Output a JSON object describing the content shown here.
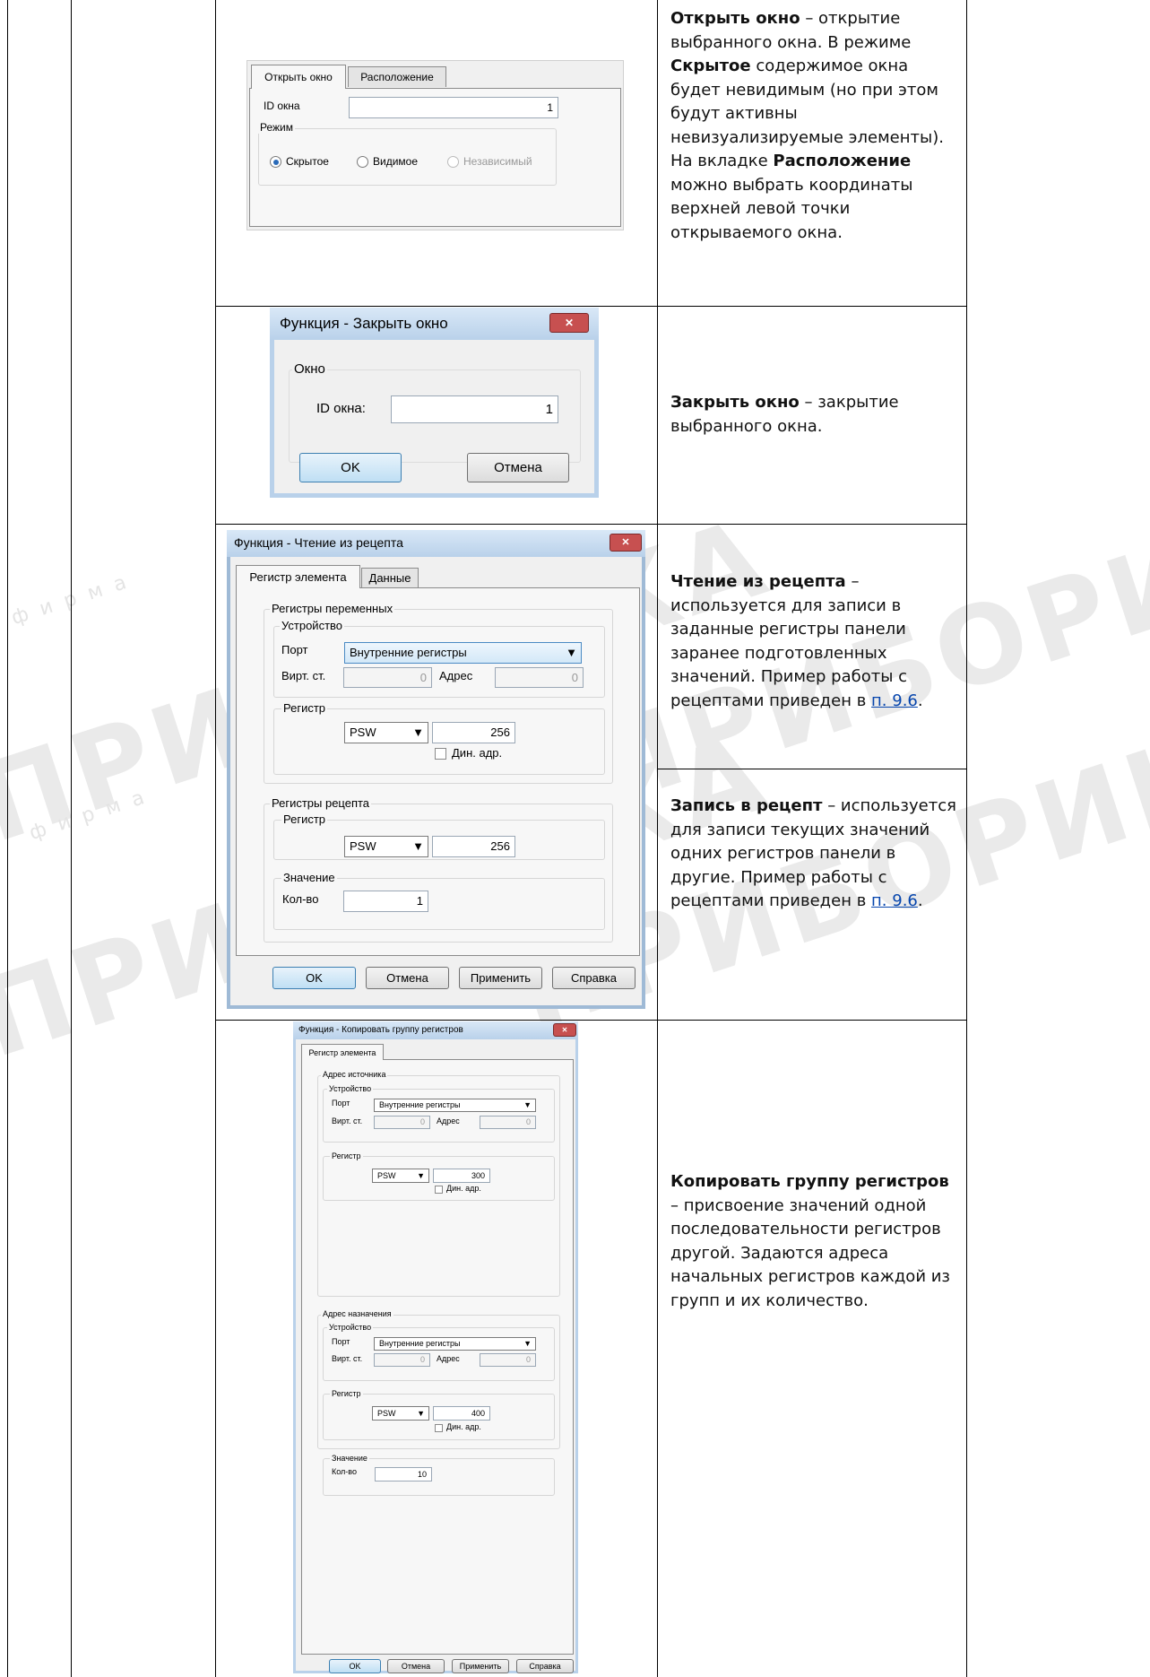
{
  "watermark": {
    "brand": "ПРИБОРИКА",
    "word": "фирма"
  },
  "rows": [
    {
      "html": "<b>Открыть окно</b> – открытие выбранного окна. В режиме <b>Скрытое</b> содержимое окна будет невидимым (но при этом будут активны невизуализируемые элементы). На вкладке <b>Расположение</b> можно выбрать координаты верхней левой точки открываемого окна."
    },
    {
      "html": "<b>Закрыть окно</b> – закрытие выбранного окна."
    },
    {
      "html": "<b>Чтение из рецепта</b> – используется для записи в заданные регистры панели заранее подготовленных значений. Пример работы с рецептами приведен в <a>п. 9.6</a>."
    },
    {
      "html": "<b>Запись в рецепт</b> – используется для записи текущих значений одних регистров панели в другие. Пример работы с рецептами приведен в <a>п. 9.6</a>."
    },
    {
      "html": "<b>Копировать группу регистров</b> – присвоение значений одной последовательности регистров другой. Задаются адреса начальных регистров каждой из групп и их количество."
    }
  ],
  "dlg_open": {
    "tab1": "Открыть окно",
    "tab2": "Расположение",
    "id_label": "ID окна",
    "id_value": "1",
    "mode_label": "Режим",
    "opt1": "Скрытое",
    "opt2": "Видимое",
    "opt3": "Независимый"
  },
  "dlg_close": {
    "title": "Функция - Закрыть окно",
    "close_glyph": "✕",
    "group": "Окно",
    "id_label": "ID окна:",
    "id_value": "1",
    "ok": "OK",
    "cancel": "Отмена"
  },
  "dlg_recipe": {
    "title": "Функция - Чтение из рецепта",
    "close_glyph": "✕",
    "tab1": "Регистр элемента",
    "tab2": "Данные",
    "grp_vars": "Регистры переменных",
    "grp_device": "Устройство",
    "port_label": "Порт",
    "port_value": "Внутренние регистры",
    "virt_label": "Вирт. ст.",
    "virt_value": "0",
    "addr_label": "Адрес",
    "addr_value": "0",
    "grp_reg": "Регистр",
    "reg_type": "PSW",
    "reg_value": "256",
    "dyn_label": "Дин. адр.",
    "grp_recipe": "Регистры рецепта",
    "grp_reg2": "Регистр",
    "reg2_type": "PSW",
    "reg2_value": "256",
    "grp_value": "Значение",
    "count_label": "Кол-во",
    "count_value": "1",
    "ok": "OK",
    "cancel": "Отмена",
    "apply": "Применить",
    "help": "Справка"
  },
  "dlg_copy": {
    "title": "Функция - Копировать группу регистров",
    "close_glyph": "✕",
    "tab1": "Регистр элемента",
    "grp_src": "Адрес источника",
    "grp_dev1": "Устройство",
    "port_label": "Порт",
    "port1_value": "Внутренние регистры",
    "virt_label": "Вирт. ст.",
    "virt1_value": "0",
    "addr_label": "Адрес",
    "addr1_value": "0",
    "grp_reg1": "Регистр",
    "reg1_type": "PSW",
    "reg1_value": "300",
    "dyn_label": "Дин. адр.",
    "grp_dst": "Адрес назначения",
    "grp_dev2": "Устройство",
    "port2_value": "Внутренние регистры",
    "virt2_value": "0",
    "addr2_value": "0",
    "grp_reg2": "Регистр",
    "reg2_type": "PSW",
    "reg2_value": "400",
    "grp_value": "Значение",
    "count_label": "Кол-во",
    "count_value": "10",
    "ok": "OK",
    "cancel": "Отмена",
    "apply": "Применить",
    "help": "Справка"
  }
}
